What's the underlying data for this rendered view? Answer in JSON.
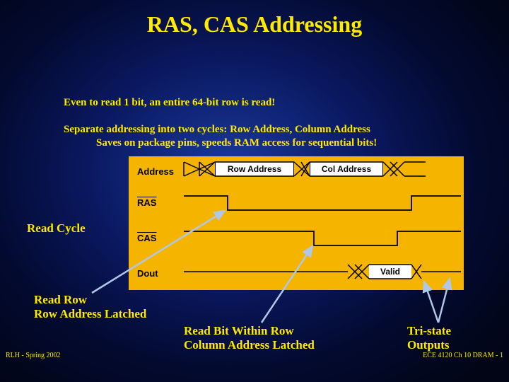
{
  "title": "RAS, CAS Addressing",
  "bullet1": "Even to read 1 bit, an entire 64-bit row is read!",
  "bullet2": "Separate addressing into two cycles: Row Address, Column Address",
  "bullet2sub": "Saves on package pins, speeds RAM access for sequential bits!",
  "read_cycle": "Read Cycle",
  "ann_readrow_l1": "Read Row",
  "ann_readrow_l2": "Row Address Latched",
  "ann_readbit_l1": "Read Bit Within Row",
  "ann_readbit_l2": "Column Address Latched",
  "ann_tristate_l1": "Tri-state",
  "ann_tristate_l2": "Outputs",
  "footer_left": "RLH - Spring 2002",
  "footer_right": "ECE 4120 Ch 10 DRAM - 1",
  "sig": {
    "address": "Address",
    "ras": "RAS",
    "cas": "CAS",
    "dout": "Dout",
    "row_addr": "Row Address",
    "col_addr": "Col Address",
    "valid": "Valid"
  }
}
